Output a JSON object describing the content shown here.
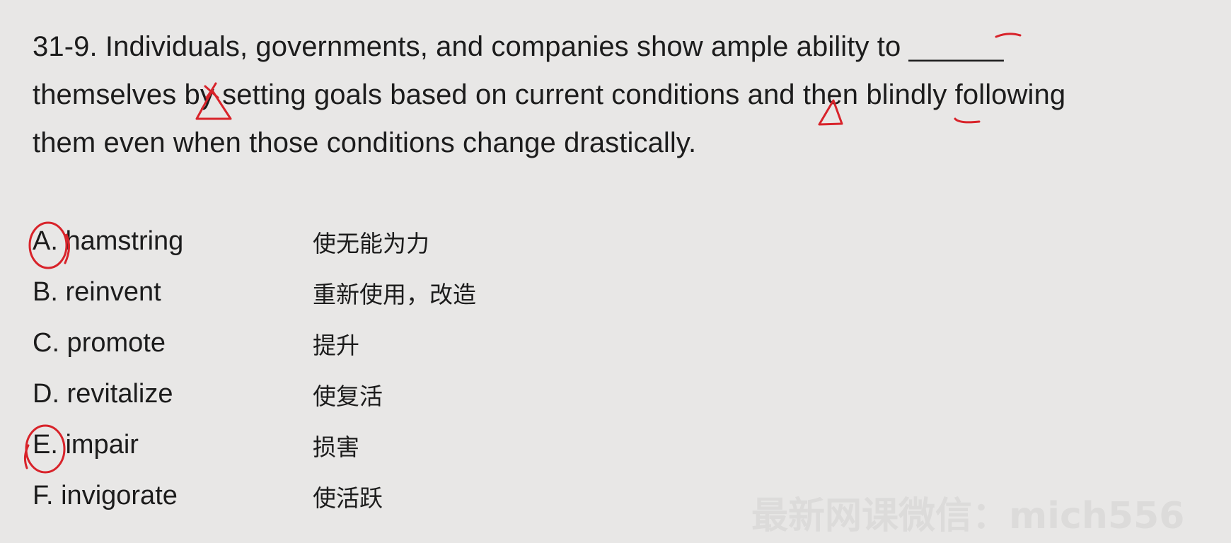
{
  "question": {
    "lines": [
      "31-9. Individuals, governments, and companies show ample ability to ______",
      "themselves by setting goals based on current conditions and then blindly following",
      "them even when those conditions change drastically."
    ]
  },
  "options": [
    {
      "label": "A. hamstring",
      "meaning": "使无能为力",
      "marked": true
    },
    {
      "label": "B. reinvent",
      "meaning": "重新使用，改造",
      "marked": false
    },
    {
      "label": "C. promote",
      "meaning": "提升",
      "marked": false
    },
    {
      "label": "D. revitalize",
      "meaning": "使复活",
      "marked": false
    },
    {
      "label": "E. impair",
      "meaning": "损害",
      "marked": true
    },
    {
      "label": "F. invigorate",
      "meaning": "使活跃",
      "marked": false
    }
  ],
  "watermark": "最新网课微信：mich556",
  "colors": {
    "background": "#e8e7e6",
    "text": "#1c1c1c",
    "annotation": "#d8232a"
  }
}
